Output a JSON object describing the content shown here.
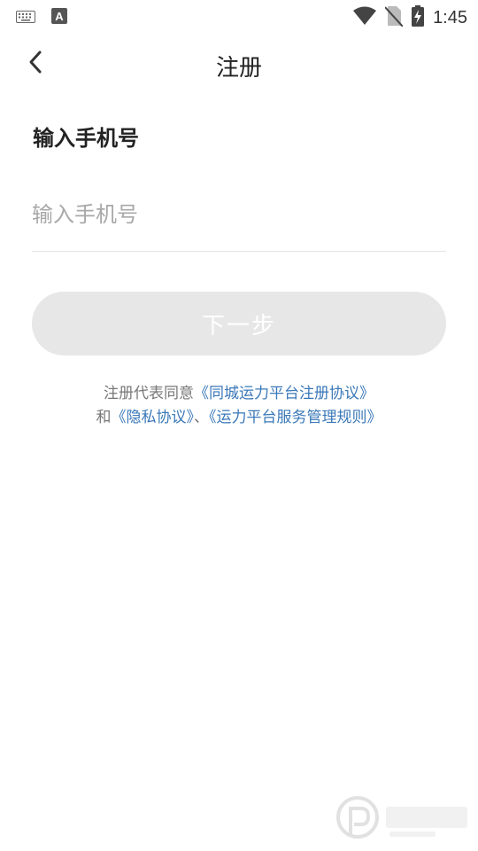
{
  "status_bar": {
    "time": "1:45",
    "left_icons": [
      "keyboard-icon",
      "text-a-icon"
    ],
    "right_icons": [
      "wifi-icon",
      "no-sim-icon",
      "battery-charging-icon"
    ]
  },
  "nav": {
    "title": "注册",
    "back_icon": "chevron-left-icon"
  },
  "form": {
    "label": "输入手机号",
    "phone_value": "",
    "phone_placeholder": "输入手机号",
    "next_label": "下一步"
  },
  "agreement": {
    "line1_prefix": "注册代表同意",
    "link_service": "《同城运力平台注册协议》",
    "line2_prefix": "和",
    "link_privacy": "《隐私协议》",
    "separator": "、",
    "link_rules": "《运力平台服务管理规则》"
  },
  "colors": {
    "link": "#3a78b8",
    "button_disabled_bg": "#e7e7e7",
    "placeholder": "#a8a8a8"
  }
}
